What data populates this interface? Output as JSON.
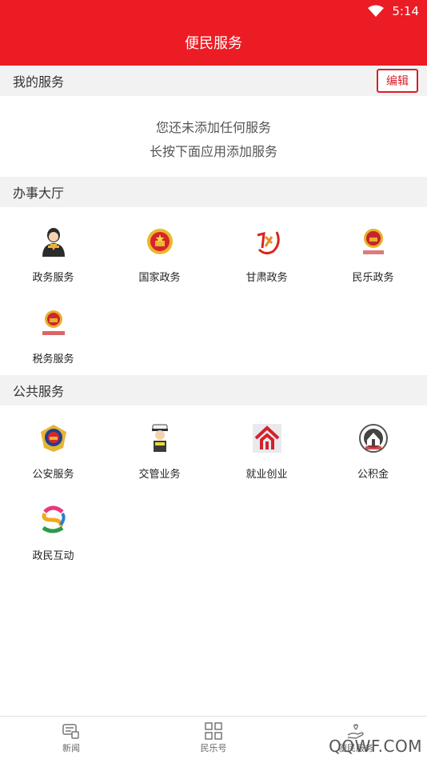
{
  "status": {
    "time": "5:14"
  },
  "header": {
    "title": "便民服务"
  },
  "my_services": {
    "title": "我的服务",
    "edit_label": "编辑",
    "empty_line1": "您还未添加任何服务",
    "empty_line2": "长按下面应用添加服务"
  },
  "hall": {
    "title": "办事大厅",
    "items": [
      {
        "label": "政务服务",
        "icon": "government-service-icon"
      },
      {
        "label": "国家政务",
        "icon": "national-emblem-icon"
      },
      {
        "label": "甘肃政务",
        "icon": "gansu-gov-icon"
      },
      {
        "label": "民乐政务",
        "icon": "minle-gov-icon"
      },
      {
        "label": "税务服务",
        "icon": "tax-service-icon"
      }
    ]
  },
  "public": {
    "title": "公共服务",
    "items": [
      {
        "label": "公安服务",
        "icon": "police-badge-icon"
      },
      {
        "label": "交管业务",
        "icon": "traffic-police-icon"
      },
      {
        "label": "就业创业",
        "icon": "employment-icon"
      },
      {
        "label": "公积金",
        "icon": "housing-fund-icon"
      },
      {
        "label": "政民互动",
        "icon": "interaction-icon"
      }
    ]
  },
  "bottom_nav": {
    "tabs": [
      {
        "label": "新闻",
        "icon": "news-icon"
      },
      {
        "label": "民乐号",
        "icon": "grid-icon"
      },
      {
        "label": "便民服务",
        "icon": "service-hand-icon"
      }
    ]
  },
  "watermark": "QQWF.COM",
  "colors": {
    "primary": "#ec1c24",
    "edit_border": "#d81e2a",
    "section_bg": "#f2f2f2"
  }
}
